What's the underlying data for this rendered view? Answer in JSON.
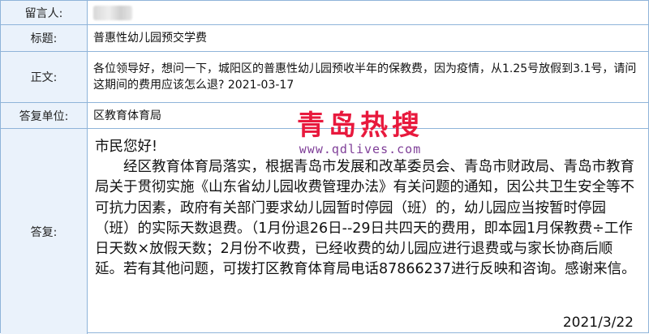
{
  "rows": {
    "author_label": "留言人:",
    "title_label": "标题:",
    "title_value": "普惠性幼儿园预交学费",
    "body_label": "正文:",
    "body_value": "各位领导好，想问一下，城阳区的普惠性幼儿园预收半年的保教费，因为疫情，从1.25号放假到3.1号，请问这期间的费用应该怎么退?   2021-03-17",
    "dept_label": "答复单位:",
    "dept_value": "区教育体育局",
    "reply_label": "答复:"
  },
  "reply": {
    "greeting": "市民您好!",
    "content": "　　经区教育体育局落实，根据青岛市发展和改革委员会、青岛市财政局、青岛市教育局关于贯彻实施《山东省幼儿园收费管理办法》有关问题的通知，因公共卫生安全等不可抗力因素，政府有关部门要求幼儿园暂时停园（班）的，幼儿园应当按暂时停园（班）的实际天数退费。（1月份退26日--29日共四天的费用，即本园1月保教费÷工作日天数×放假天数；2月份不收费，已经收费的幼儿园应进行退费或与家长协商后顺延。若有其他问题，可拨打区教育体育局电话87866237进行反映和咨询。感谢来信。",
    "date": "2021/3/22"
  },
  "watermark": {
    "chinese": "青岛热搜",
    "url": "www.qdlives.com",
    "colors": {
      "chinese": "#e8193d",
      "url": "#7f3f98"
    }
  },
  "colors": {
    "border": "#8fb4d9",
    "label_bg": "#eaf2fb"
  }
}
